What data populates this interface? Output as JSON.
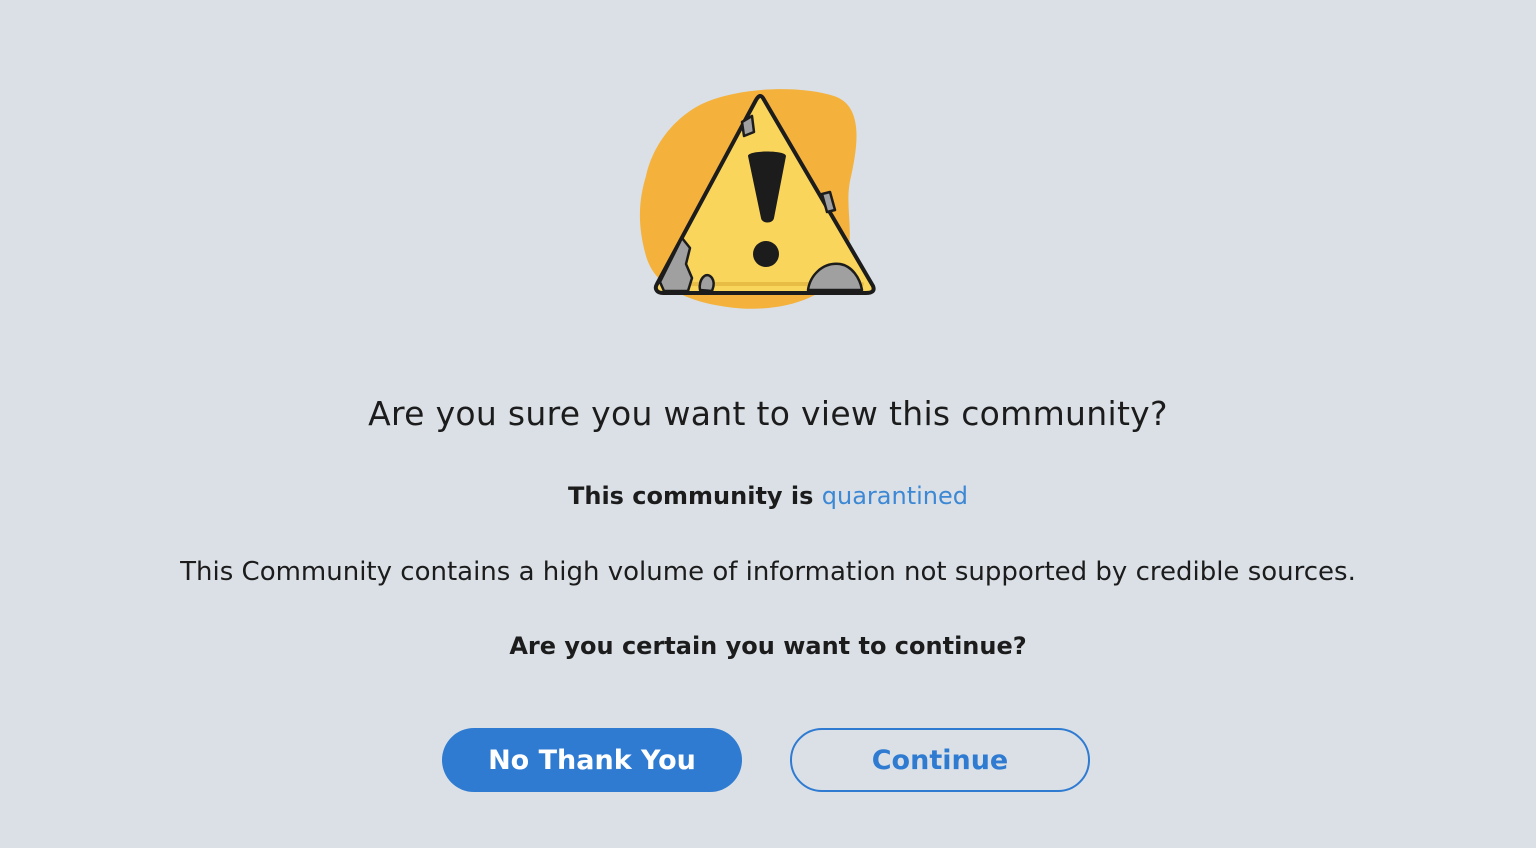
{
  "dialog": {
    "title": "Are you sure you want to view this community?",
    "status_prefix": "This community is ",
    "status_link": "quarantined",
    "description": "This Community contains a high volume of information not supported by credible sources.",
    "question": "Are you certain you want to continue?"
  },
  "buttons": {
    "decline_label": "No Thank You",
    "continue_label": "Continue"
  },
  "icons": {
    "illustration": "warning-triangle-icon"
  },
  "colors": {
    "background": "#dae0e6",
    "accent": "#2f7bd2",
    "link": "#3d88d4",
    "warning_yellow": "#f9d55b",
    "warning_orange": "#f4b13c"
  }
}
